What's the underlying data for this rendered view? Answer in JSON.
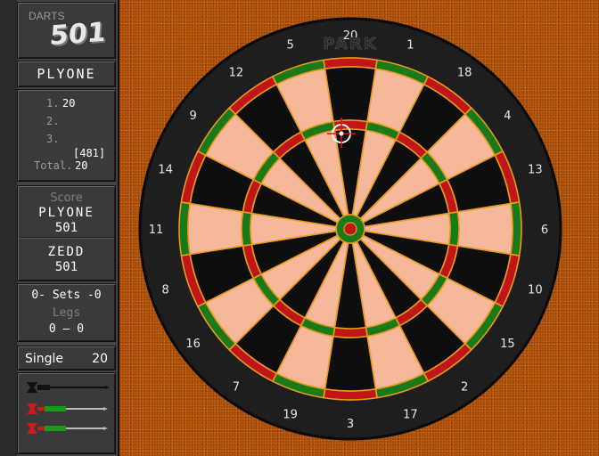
{
  "sidebar": {
    "logo_title": "DARTS",
    "logo_number": "501",
    "current_player": "PLYONE",
    "throws": [
      {
        "label": "1.",
        "value": "20"
      },
      {
        "label": "2.",
        "value": ""
      },
      {
        "label": "3.",
        "value": ""
      }
    ],
    "remaining": "[481]",
    "total_label": "Total.",
    "total_value": "20",
    "score_label": "Score",
    "players": [
      {
        "name": "PLYONE",
        "score": "501"
      },
      {
        "name": "ZEDD",
        "score": "501"
      }
    ],
    "sets_text": "0- Sets -0",
    "legs_label": "Legs",
    "legs_text": "0 – 0",
    "target_mode": "Single",
    "target_value": "20",
    "darts_remaining": [
      {
        "color": "#111111",
        "state": "thrown"
      },
      {
        "color": "#cc1a1a",
        "state": "in-hand"
      },
      {
        "color": "#cc1a1a",
        "state": "in-hand"
      }
    ]
  },
  "board": {
    "brand": "PARK",
    "numbers": [
      "20",
      "1",
      "18",
      "4",
      "13",
      "6",
      "10",
      "15",
      "2",
      "17",
      "3",
      "19",
      "7",
      "16",
      "8",
      "11",
      "14",
      "9",
      "12",
      "5"
    ],
    "colors": {
      "black": "#0e0e0e",
      "cream": "#f6b89a",
      "red": "#c0161a",
      "green": "#1a7a1a",
      "wire": "#e89a1a",
      "surround": "#1e1e1e",
      "background": "#b4560d"
    },
    "cursor_target": "20"
  }
}
